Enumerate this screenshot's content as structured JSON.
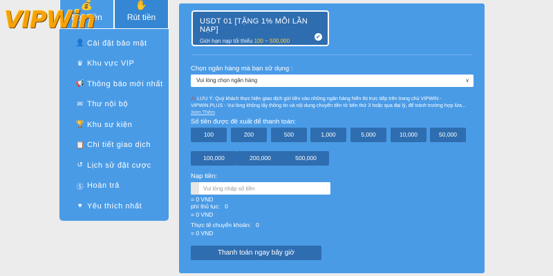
{
  "logo": {
    "text": "VIPWin"
  },
  "sidebar": {
    "tabs": [
      {
        "label": "Nạp tiền",
        "icon": "wallet-icon"
      },
      {
        "label": "Rút tiền",
        "icon": "hand-coin-icon"
      }
    ],
    "items": [
      {
        "label": "Cài đặt bảo mật",
        "icon": "user-lock-icon"
      },
      {
        "label": "Khu vực VIP",
        "icon": "crown-icon"
      },
      {
        "label": "Thông báo mới nhất",
        "icon": "megaphone-icon"
      },
      {
        "label": "Thư nội bộ",
        "icon": "envelope-icon"
      },
      {
        "label": "Khu sự kiện",
        "icon": "trophy-icon"
      },
      {
        "label": "Chi tiết giao dịch",
        "icon": "clipboard-icon"
      },
      {
        "label": "Lịch sử đặt cược",
        "icon": "history-icon"
      },
      {
        "label": "Hoàn trả",
        "icon": "dollar-circle-icon"
      },
      {
        "label": "Yêu thích nhất",
        "icon": "heart-icon"
      }
    ]
  },
  "main": {
    "promo": {
      "title": "USDT 01 [TẶNG 1% MỖI LẦN NẠP]",
      "limit_prefix": "Giới hạn nạp tối thiểu",
      "limit_min": "100",
      "limit_sep": "~",
      "limit_max": "500,000"
    },
    "bank_label": "Chọn ngân hàng mà bạn sử dụng :",
    "bank_select_value": "Vui lòng chọn ngân hàng",
    "notice_line1": "LƯU Ý: Quý khách thực hiện giao dịch gửi tiền vào những ngân hàng hiển thị trực tiếp trên trang chủ VIPWIN -",
    "notice_line2": "VIPWIN.PLUS - Vui lòng không lấy thông tin và nội dung chuyển tiền từ bên thứ 3 hoặc qua đại lý, để tránh trường hợp lừa...",
    "see_more": "Xem Thêm",
    "suggested_label": "Số tiền được đề xuất để thanh toán:",
    "amounts": [
      "100",
      "200",
      "500",
      "1,000",
      "5,000",
      "10,000",
      "50,000",
      "100,000",
      "200,000",
      "500,000"
    ],
    "deposit_label": "Nạp tiền:",
    "deposit_placeholder": "Vui lòng nhập số tiền",
    "deposit_converted": "= 0 VND",
    "fee_label": "phí thủ tục:",
    "fee_value": "0",
    "fee_converted": "= 0 VND",
    "actual_label": "Thực tế chuyển khoản:",
    "actual_value": "0",
    "actual_converted": "= 0 VND",
    "pay_button": "Thanh toán ngay bây giờ"
  }
}
